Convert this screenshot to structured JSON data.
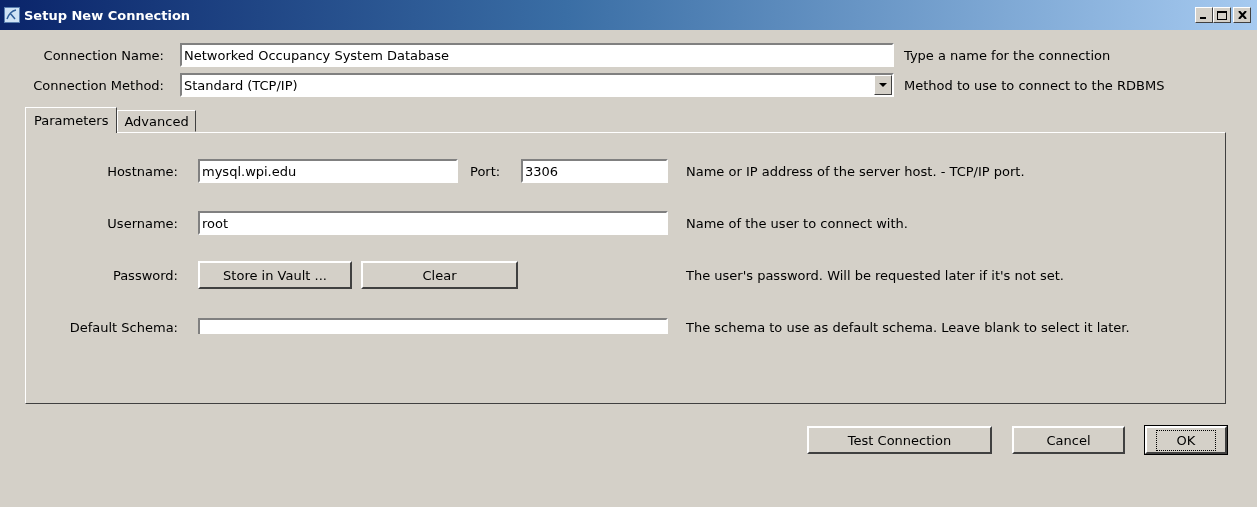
{
  "window": {
    "title": "Setup New Connection"
  },
  "connection_name": {
    "label": "Connection Name:",
    "value": "Networked Occupancy System Database",
    "help": "Type a name for the connection"
  },
  "connection_method": {
    "label": "Connection Method:",
    "value": "Standard (TCP/IP)",
    "help": "Method to use to connect to the RDBMS"
  },
  "tabs": [
    {
      "label": "Parameters",
      "selected": true
    },
    {
      "label": "Advanced",
      "selected": false
    }
  ],
  "parameters": {
    "hostname": {
      "label": "Hostname:",
      "value": "mysql.wpi.edu"
    },
    "port": {
      "label": "Port:",
      "value": "3306"
    },
    "hostname_help": "Name or IP address of the server host. - TCP/IP port.",
    "username": {
      "label": "Username:",
      "value": "root",
      "help": "Name of the user to connect with."
    },
    "password": {
      "label": "Password:",
      "buttons": [
        "Store in Vault ...",
        "Clear"
      ],
      "help": "The user's password. Will be requested later if it's not set."
    },
    "default_schema": {
      "label": "Default Schema:",
      "help": "The schema to use as default schema. Leave blank to select it later."
    }
  },
  "buttons": [
    {
      "label": "Test Connection",
      "default": false
    },
    {
      "label": "Cancel",
      "default": false
    },
    {
      "label": "OK",
      "default": true
    }
  ]
}
